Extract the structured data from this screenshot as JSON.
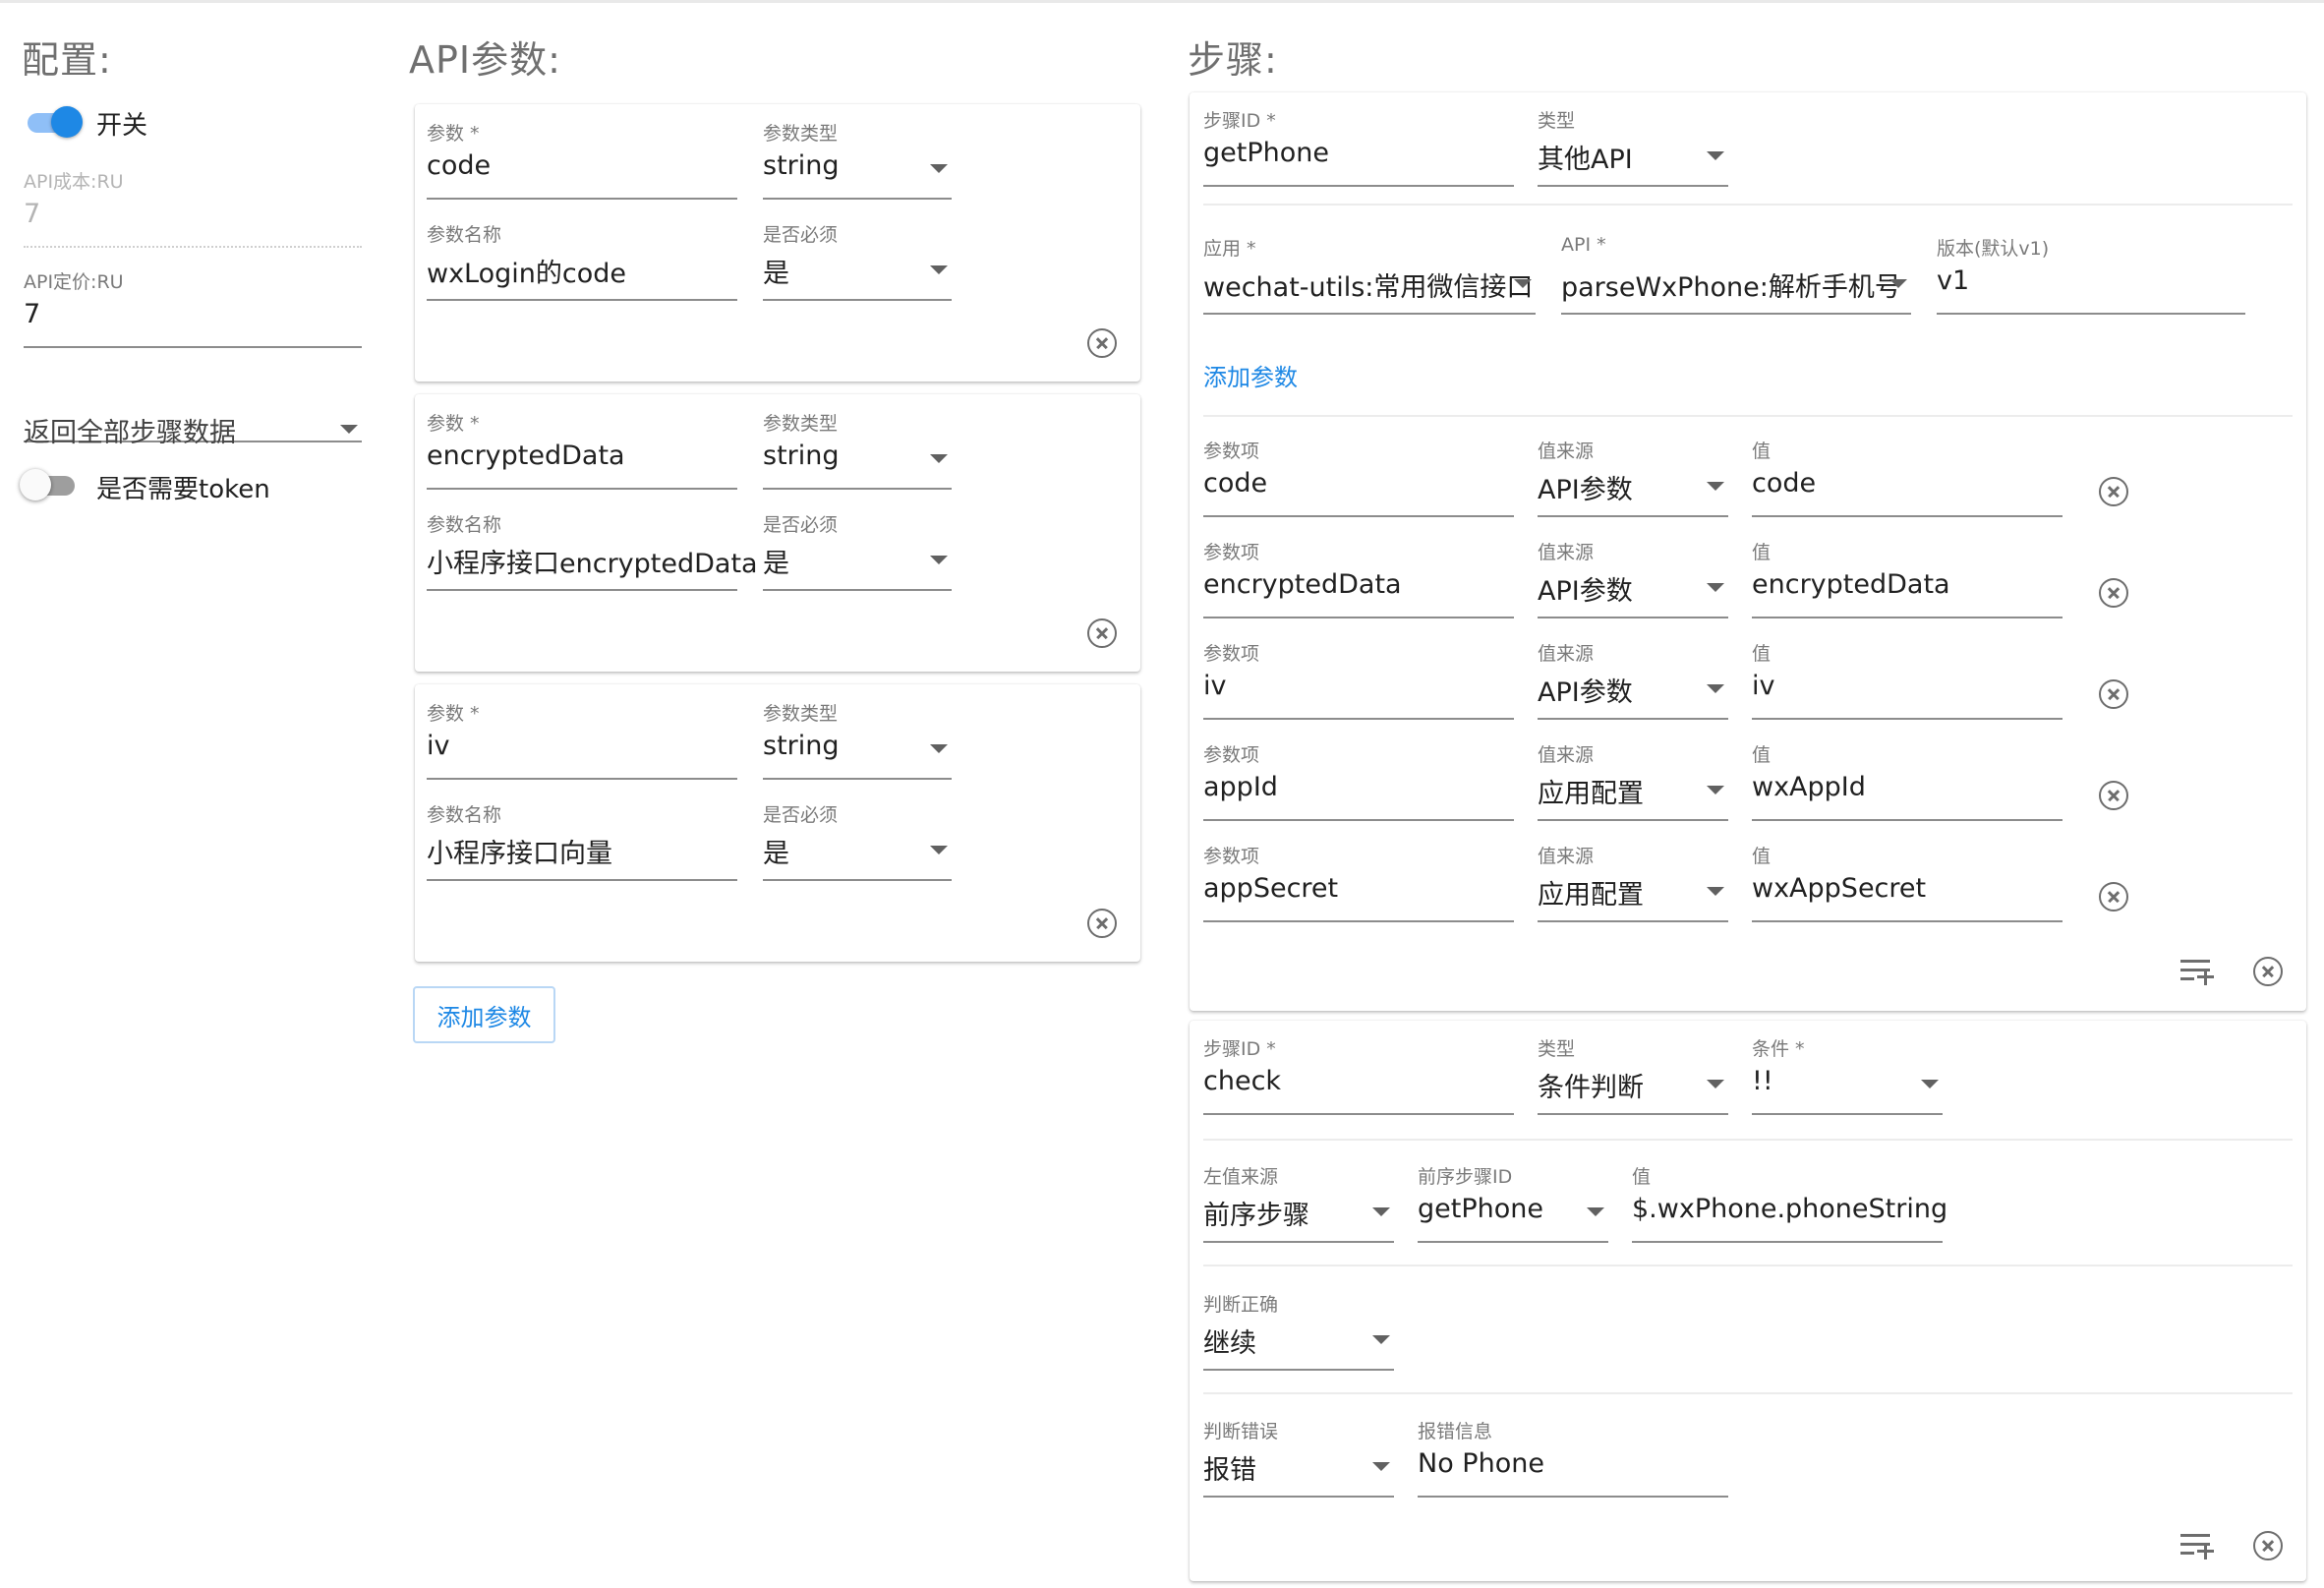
{
  "config": {
    "title": "配置:",
    "switch_label": "开关",
    "api_cost": {
      "label": "API成本:RU",
      "value": "7"
    },
    "api_price": {
      "label": "API定价:RU",
      "value": "7"
    },
    "return_select": "返回全部步骤数据",
    "token_label": "是否需要token"
  },
  "api_params": {
    "title": "API参数:",
    "labels": {
      "param": "参数 *",
      "type": "参数类型",
      "name": "参数名称",
      "required": "是否必须"
    },
    "items": [
      {
        "param": "code",
        "type": "string",
        "name": "wxLogin的code",
        "required": "是"
      },
      {
        "param": "encryptedData",
        "type": "string",
        "name": "小程序接口encryptedData",
        "required": "是"
      },
      {
        "param": "iv",
        "type": "string",
        "name": "小程序接口向量",
        "required": "是"
      }
    ],
    "add_button": "添加参数"
  },
  "steps": {
    "title": "步骤:",
    "step1": {
      "labels": {
        "id": "步骤ID *",
        "type": "类型",
        "app": "应用 *",
        "api": "API *",
        "version": "版本(默认v1)"
      },
      "id": "getPhone",
      "type": "其他API",
      "app": "wechat-utils:常用微信接口",
      "api": "parseWxPhone:解析手机号",
      "version": "v1",
      "add_param": "添加参数",
      "param_labels": {
        "item": "参数项",
        "source": "值来源",
        "value": "值"
      },
      "params": [
        {
          "item": "code",
          "source": "API参数",
          "value": "code"
        },
        {
          "item": "encryptedData",
          "source": "API参数",
          "value": "encryptedData"
        },
        {
          "item": "iv",
          "source": "API参数",
          "value": "iv"
        },
        {
          "item": "appId",
          "source": "应用配置",
          "value": "wxAppId"
        },
        {
          "item": "appSecret",
          "source": "应用配置",
          "value": "wxAppSecret"
        }
      ]
    },
    "step2": {
      "labels": {
        "id": "步骤ID *",
        "type": "类型",
        "cond": "条件 *",
        "left": "左值来源",
        "prev": "前序步骤ID",
        "value": "值",
        "true": "判断正确",
        "false": "判断错误",
        "err": "报错信息"
      },
      "id": "check",
      "type": "条件判断",
      "cond": "!!",
      "left": "前序步骤",
      "prev": "getPhone",
      "value": "$.wxPhone.phoneString",
      "true": "继续",
      "false": "报错",
      "err": "No Phone"
    }
  }
}
